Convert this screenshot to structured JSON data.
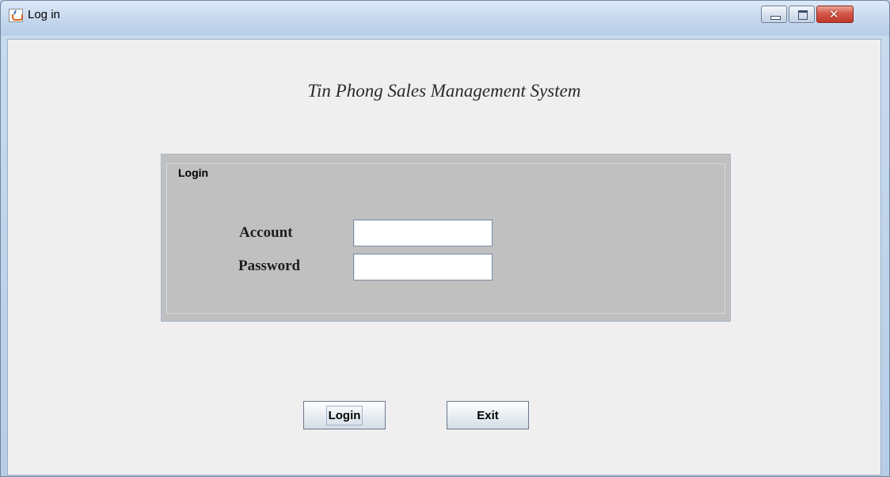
{
  "window": {
    "title": "Log in"
  },
  "titlebar": {
    "icons": {
      "app": "java-cup-icon",
      "minimize": "minimize-icon",
      "maximize": "maximize-icon",
      "close": "close-icon"
    }
  },
  "app_heading": "Tin Phong Sales Management System",
  "login_panel": {
    "legend": "Login",
    "account_label": "Account",
    "account_value": "",
    "password_label": "Password",
    "password_value": ""
  },
  "buttons": {
    "login": "Login",
    "exit": "Exit"
  },
  "colors": {
    "client_bg": "#efefef",
    "panel_bg": "#c0c0c0",
    "close_button": "#c0392b"
  }
}
